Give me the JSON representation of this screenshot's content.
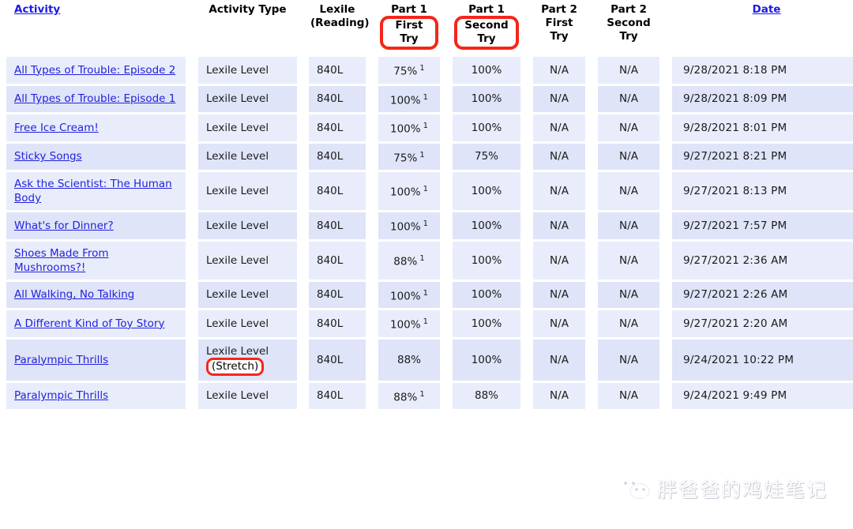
{
  "table": {
    "headers": {
      "activity": "Activity",
      "activity_type": "Activity Type",
      "lexile_line1": "Lexile",
      "lexile_line2": "(Reading)",
      "p1_line1": "Part 1",
      "p1_first_try": "First Try",
      "p1b_line1": "Part 1",
      "p1_second_try": "Second Try",
      "p2f_line1": "Part 2",
      "p2f_line2": "First",
      "p2f_line3": "Try",
      "p2s_line1": "Part 2",
      "p2s_line2": "Second",
      "p2s_line3": "Try",
      "date": "Date"
    },
    "rows": [
      {
        "activity": "All Types of Trouble: Episode 2",
        "type": "Lexile Level",
        "type_note": "",
        "lexile": "840L",
        "p1_first": "75%",
        "p1_first_footnote": "1",
        "p1_second": "100%",
        "p2_first": "N/A",
        "p2_second": "N/A",
        "date": "9/28/2021  8:18 PM"
      },
      {
        "activity": "All Types of Trouble: Episode 1",
        "type": "Lexile Level",
        "type_note": "",
        "lexile": "840L",
        "p1_first": "100%",
        "p1_first_footnote": "1",
        "p1_second": "100%",
        "p2_first": "N/A",
        "p2_second": "N/A",
        "date": "9/28/2021  8:09 PM"
      },
      {
        "activity": "Free Ice Cream!",
        "type": "Lexile Level",
        "type_note": "",
        "lexile": "840L",
        "p1_first": "100%",
        "p1_first_footnote": "1",
        "p1_second": "100%",
        "p2_first": "N/A",
        "p2_second": "N/A",
        "date": "9/28/2021  8:01 PM"
      },
      {
        "activity": "Sticky Songs",
        "type": "Lexile Level",
        "type_note": "",
        "lexile": "840L",
        "p1_first": "75%",
        "p1_first_footnote": "1",
        "p1_second": "75%",
        "p2_first": "N/A",
        "p2_second": "N/A",
        "date": "9/27/2021  8:21 PM"
      },
      {
        "activity": "Ask the Scientist: The Human Body",
        "type": "Lexile Level",
        "type_note": "",
        "lexile": "840L",
        "p1_first": "100%",
        "p1_first_footnote": "1",
        "p1_second": "100%",
        "p2_first": "N/A",
        "p2_second": "N/A",
        "date": "9/27/2021  8:13 PM"
      },
      {
        "activity": "What's for Dinner?",
        "type": "Lexile Level",
        "type_note": "",
        "lexile": "840L",
        "p1_first": "100%",
        "p1_first_footnote": "1",
        "p1_second": "100%",
        "p2_first": "N/A",
        "p2_second": "N/A",
        "date": "9/27/2021  7:57 PM"
      },
      {
        "activity": "Shoes Made From Mushrooms?!",
        "type": "Lexile Level",
        "type_note": "",
        "lexile": "840L",
        "p1_first": "88%",
        "p1_first_footnote": "1",
        "p1_second": "100%",
        "p2_first": "N/A",
        "p2_second": "N/A",
        "date": "9/27/2021  2:36 AM"
      },
      {
        "activity": "All Walking, No Talking",
        "type": "Lexile Level",
        "type_note": "",
        "lexile": "840L",
        "p1_first": "100%",
        "p1_first_footnote": "1",
        "p1_second": "100%",
        "p2_first": "N/A",
        "p2_second": "N/A",
        "date": "9/27/2021  2:26 AM"
      },
      {
        "activity": "A Different Kind of Toy Story",
        "type": "Lexile Level",
        "type_note": "",
        "lexile": "840L",
        "p1_first": "100%",
        "p1_first_footnote": "1",
        "p1_second": "100%",
        "p2_first": "N/A",
        "p2_second": "N/A",
        "date": "9/27/2021  2:20 AM"
      },
      {
        "activity": "Paralympic Thrills",
        "type": "Lexile Level",
        "type_note": "(Stretch)",
        "lexile": "840L",
        "p1_first": "88%",
        "p1_first_footnote": "",
        "p1_second": "100%",
        "p2_first": "N/A",
        "p2_second": "N/A",
        "date": "9/24/2021 10:22 PM"
      },
      {
        "activity": "Paralympic Thrills",
        "type": "Lexile Level",
        "type_note": "",
        "lexile": "840L",
        "p1_first": "88%",
        "p1_first_footnote": "1",
        "p1_second": "88%",
        "p2_first": "N/A",
        "p2_second": "N/A",
        "date": "9/24/2021  9:49 PM"
      }
    ]
  },
  "annotations": {
    "highlight_color": "#f4261a",
    "highlighted_first_try": "First Try",
    "highlighted_second_try": "Second Try",
    "highlighted_stretch": "(Stretch)"
  },
  "watermark": {
    "icon": "wechat-icon",
    "text": "胖爸爸的鸡娃笔记"
  }
}
